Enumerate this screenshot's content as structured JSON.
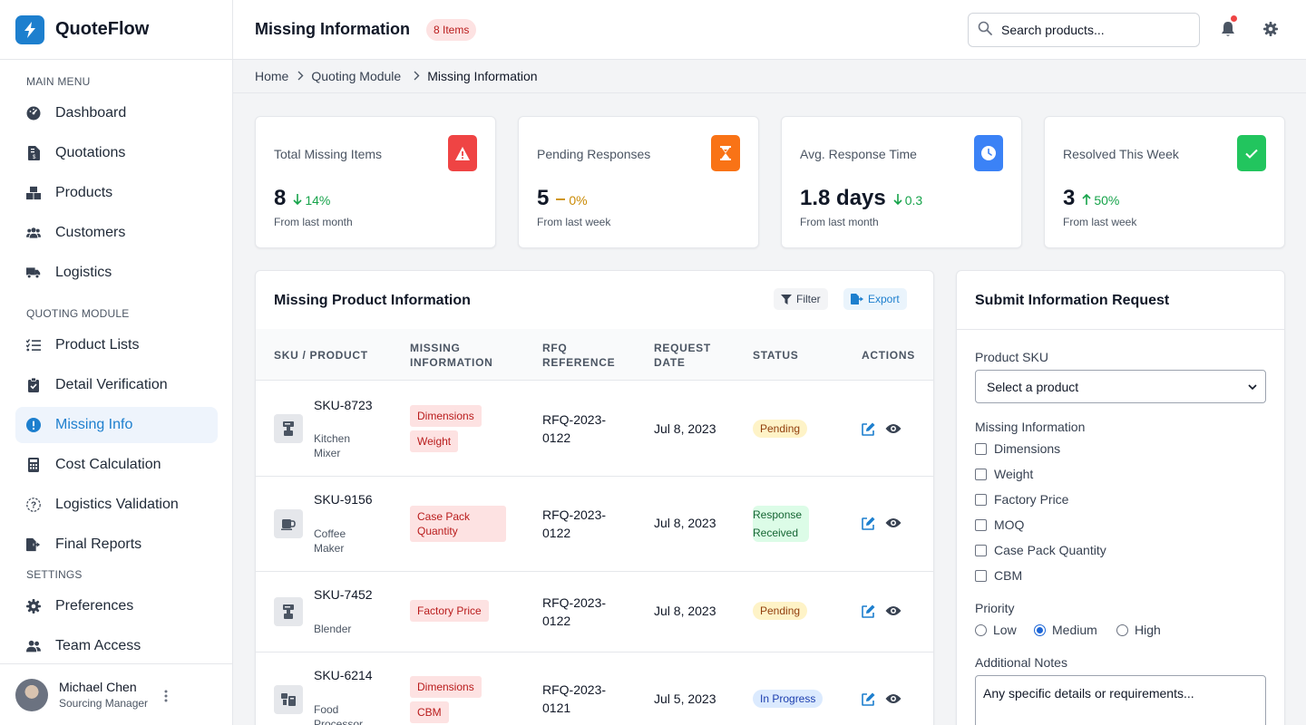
{
  "brand": {
    "name": "QuoteFlow"
  },
  "sidebar": {
    "sections": {
      "main": "MAIN MENU",
      "quoting": "QUOTING MODULE",
      "settings": "SETTINGS"
    },
    "items": [
      {
        "label": "Dashboard",
        "icon": "gauge-icon"
      },
      {
        "label": "Quotations",
        "icon": "invoice-icon"
      },
      {
        "label": "Products",
        "icon": "boxes-icon"
      },
      {
        "label": "Customers",
        "icon": "users-icon"
      },
      {
        "label": "Logistics",
        "icon": "truck-icon"
      },
      {
        "label": "Product Lists",
        "icon": "list-icon"
      },
      {
        "label": "Detail Verification",
        "icon": "clipboard-check-icon"
      },
      {
        "label": "Missing Info",
        "icon": "exclamation-circle-icon",
        "active": true
      },
      {
        "label": "Cost Calculation",
        "icon": "calculator-icon"
      },
      {
        "label": "Logistics Validation",
        "icon": "question-circle-icon"
      },
      {
        "label": "Final Reports",
        "icon": "file-export-icon"
      },
      {
        "label": "Preferences",
        "icon": "gear-icon"
      },
      {
        "label": "Team Access",
        "icon": "user-group-icon"
      }
    ],
    "user": {
      "name": "Michael Chen",
      "role": "Sourcing Manager"
    }
  },
  "header": {
    "title": "Missing Information",
    "badge": "8 Items",
    "search_placeholder": "Search products..."
  },
  "breadcrumb": [
    "Home",
    "Quoting Module",
    "Missing Information"
  ],
  "stats": [
    {
      "label": "Total Missing Items",
      "value": "8",
      "change": "14%",
      "change_dir": "down",
      "sub": "From last month",
      "color": "#ef4444"
    },
    {
      "label": "Pending Responses",
      "value": "5",
      "change": "0%",
      "change_dir": "flat",
      "sub": "From last week",
      "color": "#f97316"
    },
    {
      "label": "Avg. Response Time",
      "value": "1.8 days",
      "change": "0.3",
      "change_dir": "down",
      "sub": "From last month",
      "color": "#3b82f6"
    },
    {
      "label": "Resolved This Week",
      "value": "3",
      "change": "50%",
      "change_dir": "up",
      "sub": "From last week",
      "color": "#22c55e"
    }
  ],
  "table": {
    "title": "Missing Product Information",
    "filter_label": "Filter",
    "export_label": "Export",
    "columns": [
      "SKU / PRODUCT",
      "MISSING INFORMATION",
      "RFQ REFERENCE",
      "REQUEST DATE",
      "STATUS",
      "ACTIONS"
    ],
    "rows": [
      {
        "sku": "SKU-8723",
        "name": "Kitchen Mixer",
        "missing": [
          "Dimensions",
          "Weight"
        ],
        "rfq": "RFQ-2023-0122",
        "date": "Jul 8, 2023",
        "status": "Pending"
      },
      {
        "sku": "SKU-9156",
        "name": "Coffee Maker",
        "missing": [
          "Case Pack Quantity"
        ],
        "rfq": "RFQ-2023-0122",
        "date": "Jul 8, 2023",
        "status": "Response Received"
      },
      {
        "sku": "SKU-7452",
        "name": "Blender",
        "missing": [
          "Factory Price"
        ],
        "rfq": "RFQ-2023-0122",
        "date": "Jul 8, 2023",
        "status": "Pending"
      },
      {
        "sku": "SKU-6214",
        "name": "Food Processor",
        "missing": [
          "Dimensions",
          "CBM"
        ],
        "rfq": "RFQ-2023-0121",
        "date": "Jul 5, 2023",
        "status": "In Progress"
      }
    ]
  },
  "form": {
    "title": "Submit Information Request",
    "sku_label": "Product SKU",
    "sku_value": "Select a product",
    "missing_label": "Missing Information",
    "options": [
      "Dimensions",
      "Weight",
      "Factory Price",
      "MOQ",
      "Case Pack Quantity",
      "CBM"
    ],
    "priority_label": "Priority",
    "priorities": [
      "Low",
      "Medium",
      "High"
    ],
    "priority_selected": "Medium",
    "notes_label": "Additional Notes",
    "notes_placeholder": "Any specific details or requirements..."
  }
}
